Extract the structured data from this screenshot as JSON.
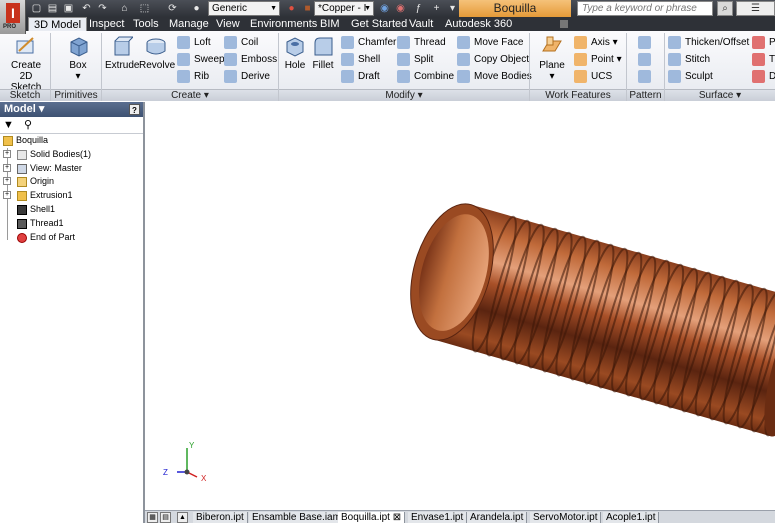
{
  "app": {
    "logo_letter": "I",
    "edition": "PRO",
    "document_title": "Boquilla"
  },
  "quick_access": {
    "appearance_dropdown": "Generic",
    "material_dropdown": "*Copper - I",
    "search_placeholder": "Type a keyword or phrase"
  },
  "tabs": [
    {
      "label": "3D Model",
      "active": true
    },
    {
      "label": "Inspect"
    },
    {
      "label": "Tools"
    },
    {
      "label": "Manage"
    },
    {
      "label": "View"
    },
    {
      "label": "Environments"
    },
    {
      "label": "BIM"
    },
    {
      "label": "Get Started"
    },
    {
      "label": "Vault"
    },
    {
      "label": "Autodesk 360"
    }
  ],
  "ribbon": {
    "sketch": {
      "panel": "Sketch",
      "create_sketch": "Create",
      "create_sketch_2": "2D Sketch"
    },
    "primitives": {
      "panel": "Primitives",
      "box": "Box"
    },
    "create": {
      "panel": "Create",
      "extrude": "Extrude",
      "revolve": "Revolve",
      "loft": "Loft",
      "sweep": "Sweep",
      "rib": "Rib",
      "coil": "Coil",
      "emboss": "Emboss",
      "derive": "Derive"
    },
    "modify": {
      "panel": "Modify",
      "hole": "Hole",
      "fillet": "Fillet",
      "chamfer": "Chamfer",
      "shell": "Shell",
      "draft": "Draft",
      "thread": "Thread",
      "split": "Split",
      "combine": "Combine",
      "move_face": "Move Face",
      "copy_object": "Copy Object",
      "move_bodies": "Move Bodies"
    },
    "work_features": {
      "panel": "Work Features",
      "plane": "Plane",
      "axis": "Axis",
      "point": "Point",
      "ucs": "UCS"
    },
    "pattern": {
      "panel": "Pattern"
    },
    "surface": {
      "panel": "Surface",
      "thicken": "Thicken/Offset",
      "stitch": "Stitch",
      "sculpt": "Sculpt",
      "p": "P",
      "t": "T",
      "d": "D"
    }
  },
  "browser": {
    "title": "Model",
    "help": "?",
    "items": [
      {
        "label": "Boquilla"
      },
      {
        "label": "Solid Bodies(1)"
      },
      {
        "label": "View: Master"
      },
      {
        "label": "Origin"
      },
      {
        "label": "Extrusion1"
      },
      {
        "label": "Shell1"
      },
      {
        "label": "Thread1"
      },
      {
        "label": "End of Part"
      }
    ]
  },
  "doc_tabs": [
    {
      "label": "Biberon.ipt"
    },
    {
      "label": "Ensamble Base.iam"
    },
    {
      "label": "Boquilla.ipt",
      "active": true
    },
    {
      "label": "Envase1.ipt"
    },
    {
      "label": "Arandela.ipt"
    },
    {
      "label": "ServoMotor.ipt"
    },
    {
      "label": "Acople1.ipt"
    }
  ],
  "triad": {
    "x": "X",
    "y": "Y",
    "z": "Z"
  },
  "colors": {
    "copper": "#b05a2c",
    "accent": "#e59a38",
    "dark_bar": "#2e3137"
  }
}
